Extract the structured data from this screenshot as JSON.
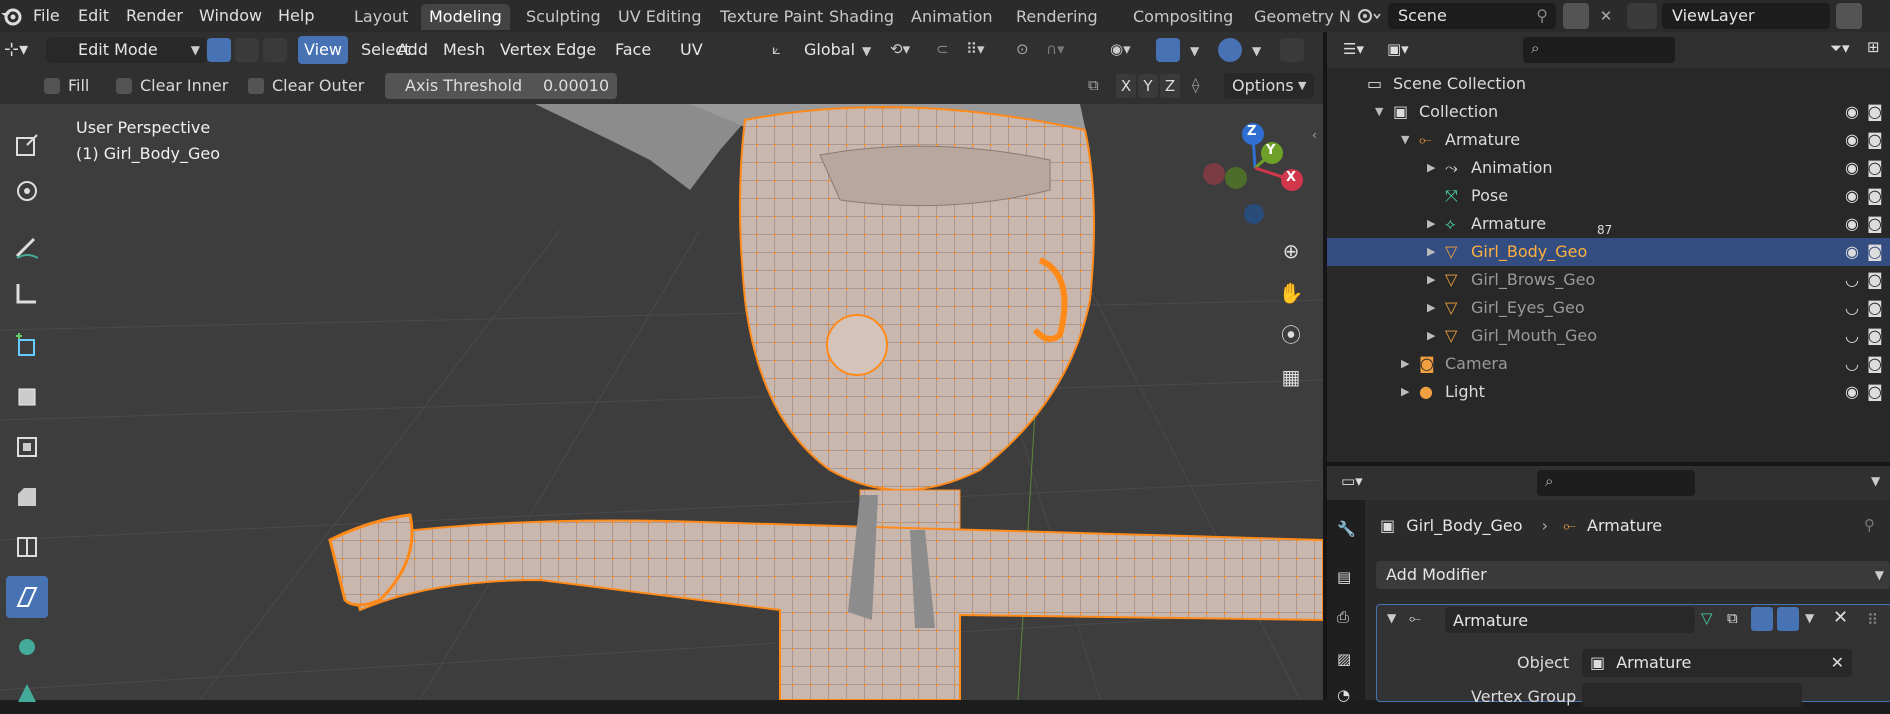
{
  "menu": [
    "File",
    "Edit",
    "Render",
    "Window",
    "Help"
  ],
  "workspaces": [
    {
      "label": "Layout",
      "active": false
    },
    {
      "label": "Modeling",
      "active": true
    },
    {
      "label": "Sculpting",
      "active": false
    },
    {
      "label": "UV Editing",
      "active": false
    },
    {
      "label": "Texture Paint",
      "active": false
    },
    {
      "label": "Shading",
      "active": false
    },
    {
      "label": "Animation",
      "active": false
    },
    {
      "label": "Rendering",
      "active": false
    },
    {
      "label": "Compositing",
      "active": false
    },
    {
      "label": "Geometry N",
      "active": false
    }
  ],
  "scene": {
    "label": "Scene"
  },
  "viewlayer": {
    "label": "ViewLayer"
  },
  "header": {
    "mode": "Edit Mode",
    "menus": [
      {
        "label": "View",
        "active": true
      },
      {
        "label": "Select",
        "active": false
      },
      {
        "label": "Add",
        "active": false
      },
      {
        "label": "Mesh",
        "active": false
      },
      {
        "label": "Vertex",
        "active": false
      },
      {
        "label": "Edge",
        "active": false
      },
      {
        "label": "Face",
        "active": false
      },
      {
        "label": "UV",
        "active": false
      }
    ],
    "orientation": "Global"
  },
  "tool_settings": {
    "fill": "Fill",
    "clear_inner": "Clear Inner",
    "clear_outer": "Clear Outer",
    "axis_threshold_label": "Axis Threshold",
    "axis_threshold_value": "0.00010",
    "axes": [
      "X",
      "Y",
      "Z"
    ],
    "options": "Options"
  },
  "viewport": {
    "perspective": "User Perspective",
    "object": "(1) Girl_Body_Geo",
    "gizmo": {
      "z": "Z",
      "y": "Y",
      "x": "X"
    }
  },
  "outliner": {
    "rows": [
      {
        "label": "Scene Collection",
        "indent": 0,
        "icon": "scene-collection-icon",
        "arrow": false,
        "selected": false,
        "dim": false
      },
      {
        "label": "Collection",
        "indent": 1,
        "icon": "collection-icon",
        "arrow": true,
        "open": true,
        "selected": false,
        "dim": false
      },
      {
        "label": "Armature",
        "indent": 2,
        "icon": "armature-icon",
        "arrow": true,
        "open": true,
        "selected": false,
        "dim": false
      },
      {
        "label": "Animation",
        "indent": 3,
        "icon": "animation-icon",
        "arrow": true,
        "open": false,
        "selected": false,
        "dim": false
      },
      {
        "label": "Pose",
        "indent": 3,
        "icon": "pose-icon",
        "arrow": false,
        "selected": false,
        "dim": false
      },
      {
        "label": "Armature",
        "indent": 3,
        "icon": "armature-data-icon",
        "arrow": true,
        "open": false,
        "selected": false,
        "dim": false,
        "badge": "87"
      },
      {
        "label": "Girl_Body_Geo",
        "indent": 3,
        "icon": "mesh-icon",
        "arrow": true,
        "open": false,
        "selected": true,
        "dim": false
      },
      {
        "label": "Girl_Brows_Geo",
        "indent": 3,
        "icon": "mesh-icon",
        "arrow": true,
        "open": false,
        "selected": false,
        "dim": true
      },
      {
        "label": "Girl_Eyes_Geo",
        "indent": 3,
        "icon": "mesh-icon",
        "arrow": true,
        "open": false,
        "selected": false,
        "dim": true
      },
      {
        "label": "Girl_Mouth_Geo",
        "indent": 3,
        "icon": "mesh-icon",
        "arrow": true,
        "open": false,
        "selected": false,
        "dim": true
      },
      {
        "label": "Camera",
        "indent": 2,
        "icon": "camera-icon",
        "arrow": true,
        "open": false,
        "selected": false,
        "dim": true
      },
      {
        "label": "Light",
        "indent": 2,
        "icon": "light-icon",
        "arrow": true,
        "open": false,
        "selected": false,
        "dim": false
      }
    ]
  },
  "properties": {
    "breadcrumb_object": "Girl_Body_Geo",
    "breadcrumb_modifier": "Armature",
    "add_modifier": "Add Modifier",
    "modifier_name": "Armature",
    "object_label": "Object",
    "object_value": "Armature",
    "vertex_group_label": "Vertex Group"
  }
}
